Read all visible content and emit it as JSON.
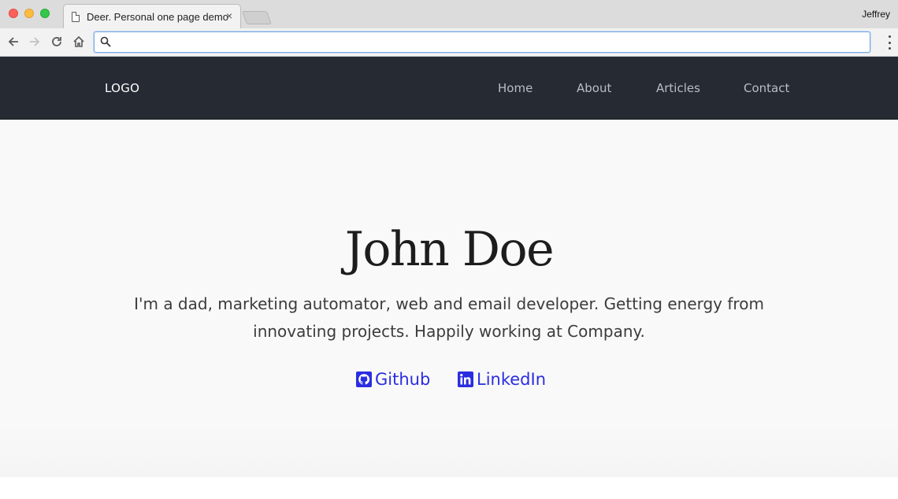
{
  "browser": {
    "tab_title": "Deer. Personal one page demo",
    "tab_close": "×",
    "profile_name": "Jeffrey",
    "address_value": ""
  },
  "site": {
    "logo": "LOGO",
    "nav": {
      "home": "Home",
      "about": "About",
      "articles": "Articles",
      "contact": "Contact"
    }
  },
  "hero": {
    "name": "John Doe",
    "bio": "I'm a dad, marketing automator, web and email developer. Getting energy from innovating projects. Happily working at Company.",
    "links": {
      "github": "Github",
      "linkedin": "LinkedIn"
    }
  },
  "colors": {
    "nav_bg": "#262a33",
    "hero_bg": "#f9f9f9",
    "link": "#2b2de0"
  }
}
